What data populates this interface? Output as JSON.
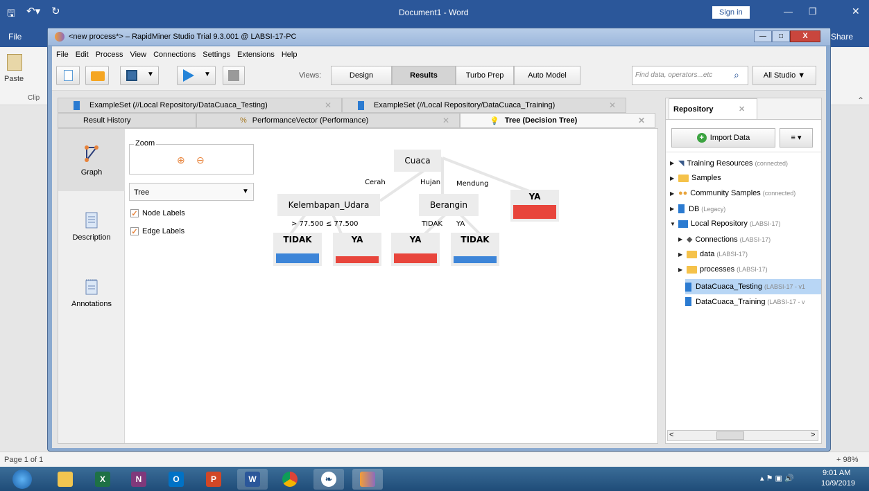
{
  "word": {
    "title": "Document1 - Word",
    "file_tab": "File",
    "sign_in": "Sign in",
    "share": "Share",
    "paste": "Paste",
    "clip": "Clip",
    "page": "Page 1 of 1",
    "zoom": "+ 98%"
  },
  "window": {
    "title": "<new process*> – RapidMiner Studio Trial 9.3.001 @ LABSI-17-PC"
  },
  "menu": [
    "File",
    "Edit",
    "Process",
    "View",
    "Connections",
    "Settings",
    "Extensions",
    "Help"
  ],
  "views": {
    "label": "Views:",
    "buttons": [
      "Design",
      "Results",
      "Turbo Prep",
      "Auto Model"
    ],
    "active": "Results"
  },
  "search": {
    "placeholder": "Find data, operators...etc",
    "scope": "All Studio ▼"
  },
  "tabs_row1": [
    "ExampleSet (//Local Repository/DataCuaca_Testing)",
    "ExampleSet (//Local Repository/DataCuaca_Training)"
  ],
  "tabs_row2": [
    "Result History",
    "PerformanceVector (Performance)",
    "Tree (Decision Tree)"
  ],
  "side": {
    "graph": "Graph",
    "description": "Description",
    "annotations": "Annotations"
  },
  "controls": {
    "zoom_label": "Zoom",
    "layout_select": "Tree",
    "node_labels": "Node Labels",
    "edge_labels": "Edge Labels"
  },
  "tree": {
    "root": "Cuaca",
    "edges": {
      "cerah": "Cerah",
      "hujan": "Hujan",
      "mendung": "Mendung",
      "gt": "> 77.500",
      "le": "≤ 77.500",
      "tidak": "TIDAK",
      "ya": "YA"
    },
    "nodes": {
      "kelembapan": "Kelembapan_Udara",
      "berangin": "Berangin"
    },
    "leaves": [
      "TIDAK",
      "YA",
      "YA",
      "TIDAK",
      "YA"
    ],
    "colors": {
      "ya": "#e8453c",
      "tidak": "#3d85d8"
    }
  },
  "repository": {
    "title": "Repository",
    "import": "Import Data",
    "items": [
      {
        "label": "Training Resources",
        "sub": "(connected)"
      },
      {
        "label": "Samples",
        "sub": ""
      },
      {
        "label": "Community Samples",
        "sub": "(connected)"
      },
      {
        "label": "DB",
        "sub": "(Legacy)"
      },
      {
        "label": "Local Repository",
        "sub": "(LABSI-17)"
      },
      {
        "label": "Connections",
        "sub": "(LABSI-17)"
      },
      {
        "label": "data",
        "sub": "(LABSI-17)"
      },
      {
        "label": "processes",
        "sub": "(LABSI-17)"
      },
      {
        "label": "DataCuaca_Testing",
        "sub": "(LABSI-17 - v1"
      },
      {
        "label": "DataCuaca_Training",
        "sub": "(LABSI-17 - v"
      }
    ]
  },
  "taskbar": {
    "time": "9:01 AM",
    "date": "10/9/2019"
  }
}
